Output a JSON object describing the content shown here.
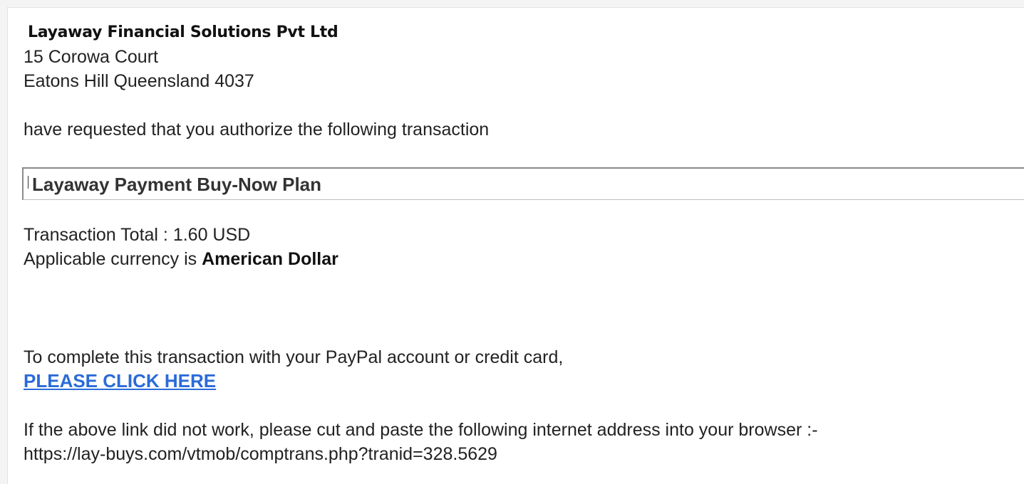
{
  "merchant": {
    "name": "Layaway Financial Solutions Pvt Ltd",
    "address_line1": "15 Corowa Court",
    "address_line2": "Eatons Hill Queensland 4037"
  },
  "request_text": "have requested that you authorize the following transaction",
  "transaction": {
    "description": "Layaway Payment Buy-Now Plan",
    "total_text": "Transaction Total : 1.60 USD",
    "currency_prefix": "Applicable currency is ",
    "currency_name": "American Dollar"
  },
  "action": {
    "intro_text": "To complete this transaction with your PayPal account or credit card,",
    "link_label": "PLEASE CLICK HERE",
    "link_color": "#2a6bd8"
  },
  "fallback": {
    "text": "If the above link did not work, please cut and paste the following internet address into your browser :-",
    "url": "https://lay-buys.com/vtmob/comptrans.php?tranid=328.5629"
  }
}
